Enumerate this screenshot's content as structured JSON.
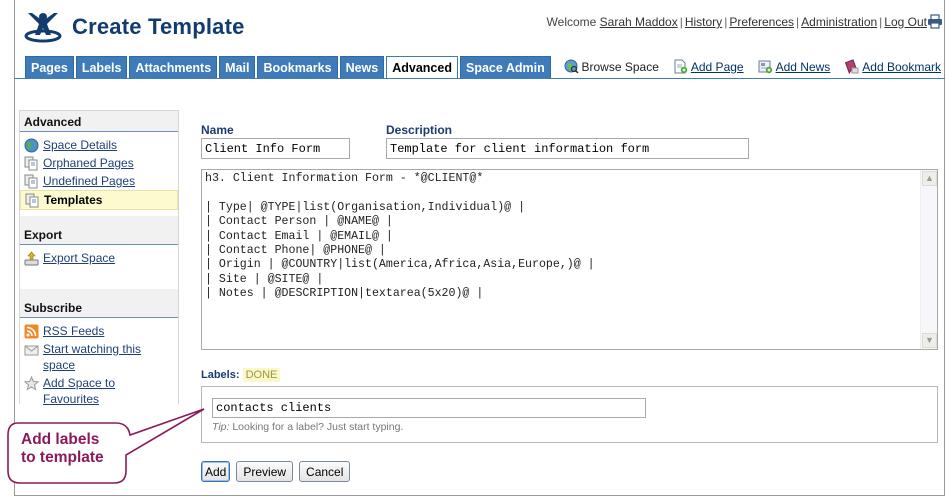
{
  "header": {
    "title": "Create Template",
    "welcome": "Welcome",
    "user_name": "Sarah Maddox",
    "links": [
      "History",
      "Preferences",
      "Administration",
      "Log Out"
    ]
  },
  "tabs": [
    {
      "label": "Pages",
      "active": false
    },
    {
      "label": "Labels",
      "active": false
    },
    {
      "label": "Attachments",
      "active": false
    },
    {
      "label": "Mail",
      "active": false
    },
    {
      "label": "Bookmarks",
      "active": false
    },
    {
      "label": "News",
      "active": false
    },
    {
      "label": "Advanced",
      "active": true
    },
    {
      "label": "Space Admin",
      "active": false
    }
  ],
  "actions": {
    "browse_space": "Browse Space",
    "add_page": "Add Page",
    "add_news": "Add News",
    "add_bookmark": "Add Bookmark"
  },
  "sidebar": {
    "advanced": {
      "heading": "Advanced",
      "items": [
        {
          "label": "Space Details",
          "icon": "globe-icon"
        },
        {
          "label": "Orphaned Pages",
          "icon": "pages-icon"
        },
        {
          "label": "Undefined Pages",
          "icon": "pages-icon"
        },
        {
          "label": "Templates",
          "icon": "pages-icon",
          "active": true
        }
      ]
    },
    "export": {
      "heading": "Export",
      "items": [
        {
          "label": "Export Space",
          "icon": "export-icon"
        }
      ]
    },
    "subscribe": {
      "heading": "Subscribe",
      "items": [
        {
          "label": "RSS Feeds",
          "icon": "rss-icon"
        },
        {
          "label": "Start watching this space",
          "icon": "envelope-icon"
        },
        {
          "label": "Add Space to Favourites",
          "icon": "star-icon"
        }
      ]
    }
  },
  "form": {
    "name_label": "Name",
    "name_value": "Client Info Form",
    "description_label": "Description",
    "description_value": "Template for client information form",
    "content": "h3. Client Information Form - *@CLIENT@*\n\n| Type| @TYPE|list(Organisation,Individual)@ |\n| Contact Person | @NAME@ |\n| Contact Email | @EMAIL@ |\n| Contact Phone| @PHONE@ |\n| Origin | @COUNTRY|list(America,Africa,Asia,Europe,)@ |\n| Site | @SITE@ |\n| Notes | @DESCRIPTION|textarea(5x20)@ |",
    "labels_label": "Labels:",
    "labels_done": "DONE",
    "labels_value": "contacts clients",
    "tip_prefix": "Tip:",
    "tip_text": " Looking for a label? Just start typing.",
    "buttons": {
      "add": "Add",
      "preview": "Preview",
      "cancel": "Cancel"
    }
  },
  "callout": {
    "line1": "Add labels",
    "line2": "to template",
    "color": "#8b1a5a"
  }
}
